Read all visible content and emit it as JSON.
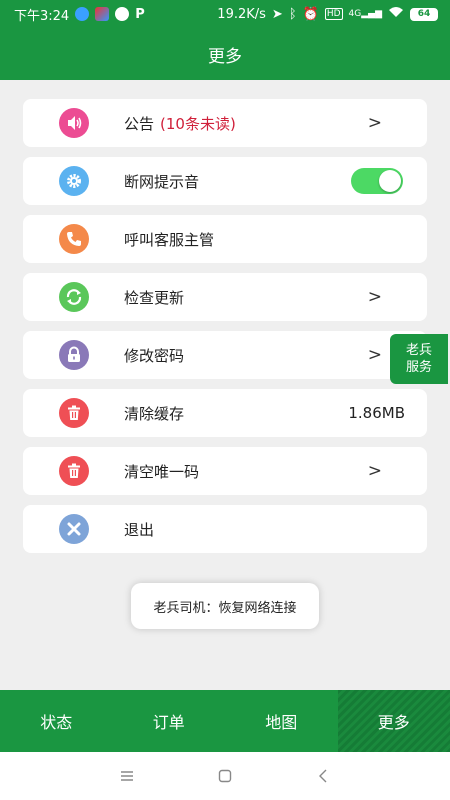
{
  "status_bar": {
    "time": "下午3:24",
    "network_speed": "19.2K/s",
    "battery": "64",
    "network_type": "4G"
  },
  "header": {
    "title": "更多"
  },
  "menu": [
    {
      "label": "公告",
      "badge": "(10条未读)",
      "icon": "speaker-icon",
      "icon_color": "#ec4c93",
      "arrow": ">"
    },
    {
      "label": "断网提示音",
      "icon": "gear-icon",
      "icon_color": "#5bb2f0",
      "toggle_on": true
    },
    {
      "label": "呼叫客服主管",
      "icon": "phone-icon",
      "icon_color": "#f4894a"
    },
    {
      "label": "检查更新",
      "icon": "refresh-icon",
      "icon_color": "#5ac75a",
      "arrow": ">"
    },
    {
      "label": "修改密码",
      "icon": "lock-icon",
      "icon_color": "#8a79b8",
      "arrow": ">"
    },
    {
      "label": "清除缓存",
      "icon": "trash-icon",
      "icon_color": "#ef4f55",
      "value": "1.86MB"
    },
    {
      "label": "清空唯一码",
      "icon": "trash-icon",
      "icon_color": "#ef4f55",
      "arrow": ">"
    },
    {
      "label": "退出",
      "icon": "close-icon",
      "icon_color": "#7ea4d8"
    }
  ],
  "float_button": {
    "line1": "老兵",
    "line2": "服务"
  },
  "toast": {
    "text": "老兵司机：恢复网络连接"
  },
  "tabs": [
    {
      "label": "状态",
      "active": false
    },
    {
      "label": "订单",
      "active": false
    },
    {
      "label": "地图",
      "active": false
    },
    {
      "label": "更多",
      "active": true
    }
  ],
  "colors": {
    "primary": "#1a9641",
    "toggle_on": "#4cd964",
    "badge": "#d0203a"
  }
}
